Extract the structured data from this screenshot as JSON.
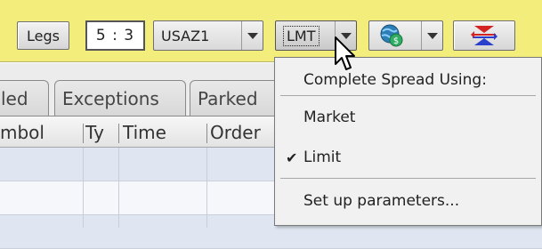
{
  "toolbar": {
    "legs_label": "Legs",
    "ratio_value": "5 : 3",
    "symbol_value": "USAZ1",
    "order_type_value": "LMT",
    "icon_combo": {
      "icon": "globe-dollar-icon"
    },
    "swap_button": {
      "icon": "swap-arrows-icon"
    },
    "colors": {
      "toolbar_bg": "#f3ee7c",
      "swap_red": "#d42323",
      "swap_blue": "#2a3fcc"
    }
  },
  "tabs": [
    {
      "label": "led"
    },
    {
      "label": "Exceptions"
    },
    {
      "label": "Parked"
    }
  ],
  "table": {
    "columns": [
      "mbol",
      "Ty",
      "Time",
      "Order"
    ]
  },
  "menu": {
    "header": "Complete Spread Using:",
    "items": [
      {
        "label": "Market",
        "checked": false
      },
      {
        "label": "Limit",
        "checked": true
      }
    ],
    "setup_label": "Set up parameters...",
    "checkmark": "✔"
  }
}
